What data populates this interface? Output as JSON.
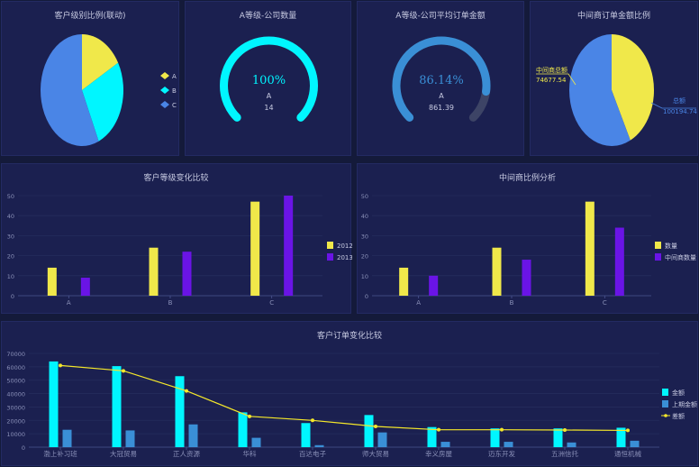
{
  "charts": {
    "pie1": {
      "title": "客户级别比例(联动)"
    },
    "gauge1": {
      "title": "A等级-公司数量"
    },
    "gauge2": {
      "title": "A等级-公司平均订单金额"
    },
    "pie2": {
      "title": "中间商订单金额比例"
    },
    "bar1": {
      "title": "客户等级变化比较"
    },
    "bar2": {
      "title": "中间商比例分析"
    },
    "combo": {
      "title": "客户订单变化比较"
    }
  },
  "colors": {
    "yellow": "#f0e84a",
    "cyan": "#00f6ff",
    "blue": "#4a85e6",
    "purple": "#6a14e6",
    "lightblue": "#3a8fd6",
    "line": "#f5e82a"
  },
  "chart_data": [
    {
      "id": "pie1",
      "type": "pie",
      "title": "客户级别比例(联动)",
      "slices": [
        {
          "name": "A",
          "value": 14,
          "color": "#f0e84a"
        },
        {
          "name": "B",
          "value": 22,
          "color": "#00f6ff"
        },
        {
          "name": "C",
          "value": 47,
          "color": "#4a85e6"
        }
      ],
      "legend": "right"
    },
    {
      "id": "gauge1",
      "type": "gauge",
      "title": "A等级-公司数量",
      "percent_label": "100%",
      "percent": 1.0,
      "name": "A",
      "value": "14",
      "color": "#00f6ff"
    },
    {
      "id": "gauge2",
      "type": "gauge",
      "title": "A等级-公司平均订单金额",
      "percent_label": "86.14%",
      "percent": 0.8614,
      "name": "A",
      "value": "861.39",
      "color": "#3a8fd6"
    },
    {
      "id": "pie2",
      "type": "pie",
      "title": "中间商订单金额比例",
      "slices": [
        {
          "name": "中间商总额",
          "value": 74677.54,
          "label_value": "74677.54",
          "color": "#f0e84a"
        },
        {
          "name": "总额",
          "value": 100194.74,
          "label_value": "100194.74",
          "color": "#4a85e6"
        }
      ]
    },
    {
      "id": "bar1",
      "type": "bar",
      "title": "客户等级变化比较",
      "categories": [
        "A",
        "B",
        "C"
      ],
      "series": [
        {
          "name": "2012",
          "values": [
            14,
            24,
            47
          ],
          "color": "#f0e84a"
        },
        {
          "name": "2013",
          "values": [
            9,
            22,
            50
          ],
          "color": "#6a14e6"
        }
      ],
      "ylim": [
        0,
        50
      ],
      "yticks": [
        0,
        10,
        20,
        30,
        40,
        50
      ],
      "legend": "right"
    },
    {
      "id": "bar2",
      "type": "bar",
      "title": "中间商比例分析",
      "categories": [
        "A",
        "B",
        "C"
      ],
      "series": [
        {
          "name": "数量",
          "values": [
            14,
            24,
            47
          ],
          "color": "#f0e84a"
        },
        {
          "name": "中间商数量",
          "values": [
            10,
            18,
            34
          ],
          "color": "#6a14e6"
        }
      ],
      "ylim": [
        0,
        50
      ],
      "yticks": [
        0,
        10,
        20,
        30,
        40,
        50
      ],
      "legend": "right"
    },
    {
      "id": "combo",
      "type": "bar",
      "title": "客户订单变化比较",
      "categories": [
        "渤上补习班",
        "大冠贸易",
        "正人资源",
        "华科",
        "百达电子",
        "师大贸易",
        "幸义房屋",
        "迈东开发",
        "五洲信托",
        "通恒机械"
      ],
      "series": [
        {
          "name": "金额",
          "type": "bar",
          "values": [
            64000,
            60500,
            53000,
            26000,
            18000,
            24000,
            15000,
            14000,
            14000,
            14500
          ],
          "color": "#00f6ff"
        },
        {
          "name": "上期金额",
          "type": "bar",
          "values": [
            13000,
            12500,
            17000,
            7000,
            1500,
            11000,
            4000,
            4000,
            3500,
            4800
          ],
          "color": "#3a8fd6"
        },
        {
          "name": "差额",
          "type": "line",
          "values": [
            61000,
            57000,
            42000,
            23000,
            20000,
            15500,
            13000,
            13000,
            12800,
            12500
          ],
          "color": "#f5e82a"
        }
      ],
      "ylim": [
        0,
        70000
      ],
      "yticks": [
        0,
        10000,
        20000,
        30000,
        40000,
        50000,
        60000,
        70000
      ],
      "legend": "right"
    }
  ]
}
